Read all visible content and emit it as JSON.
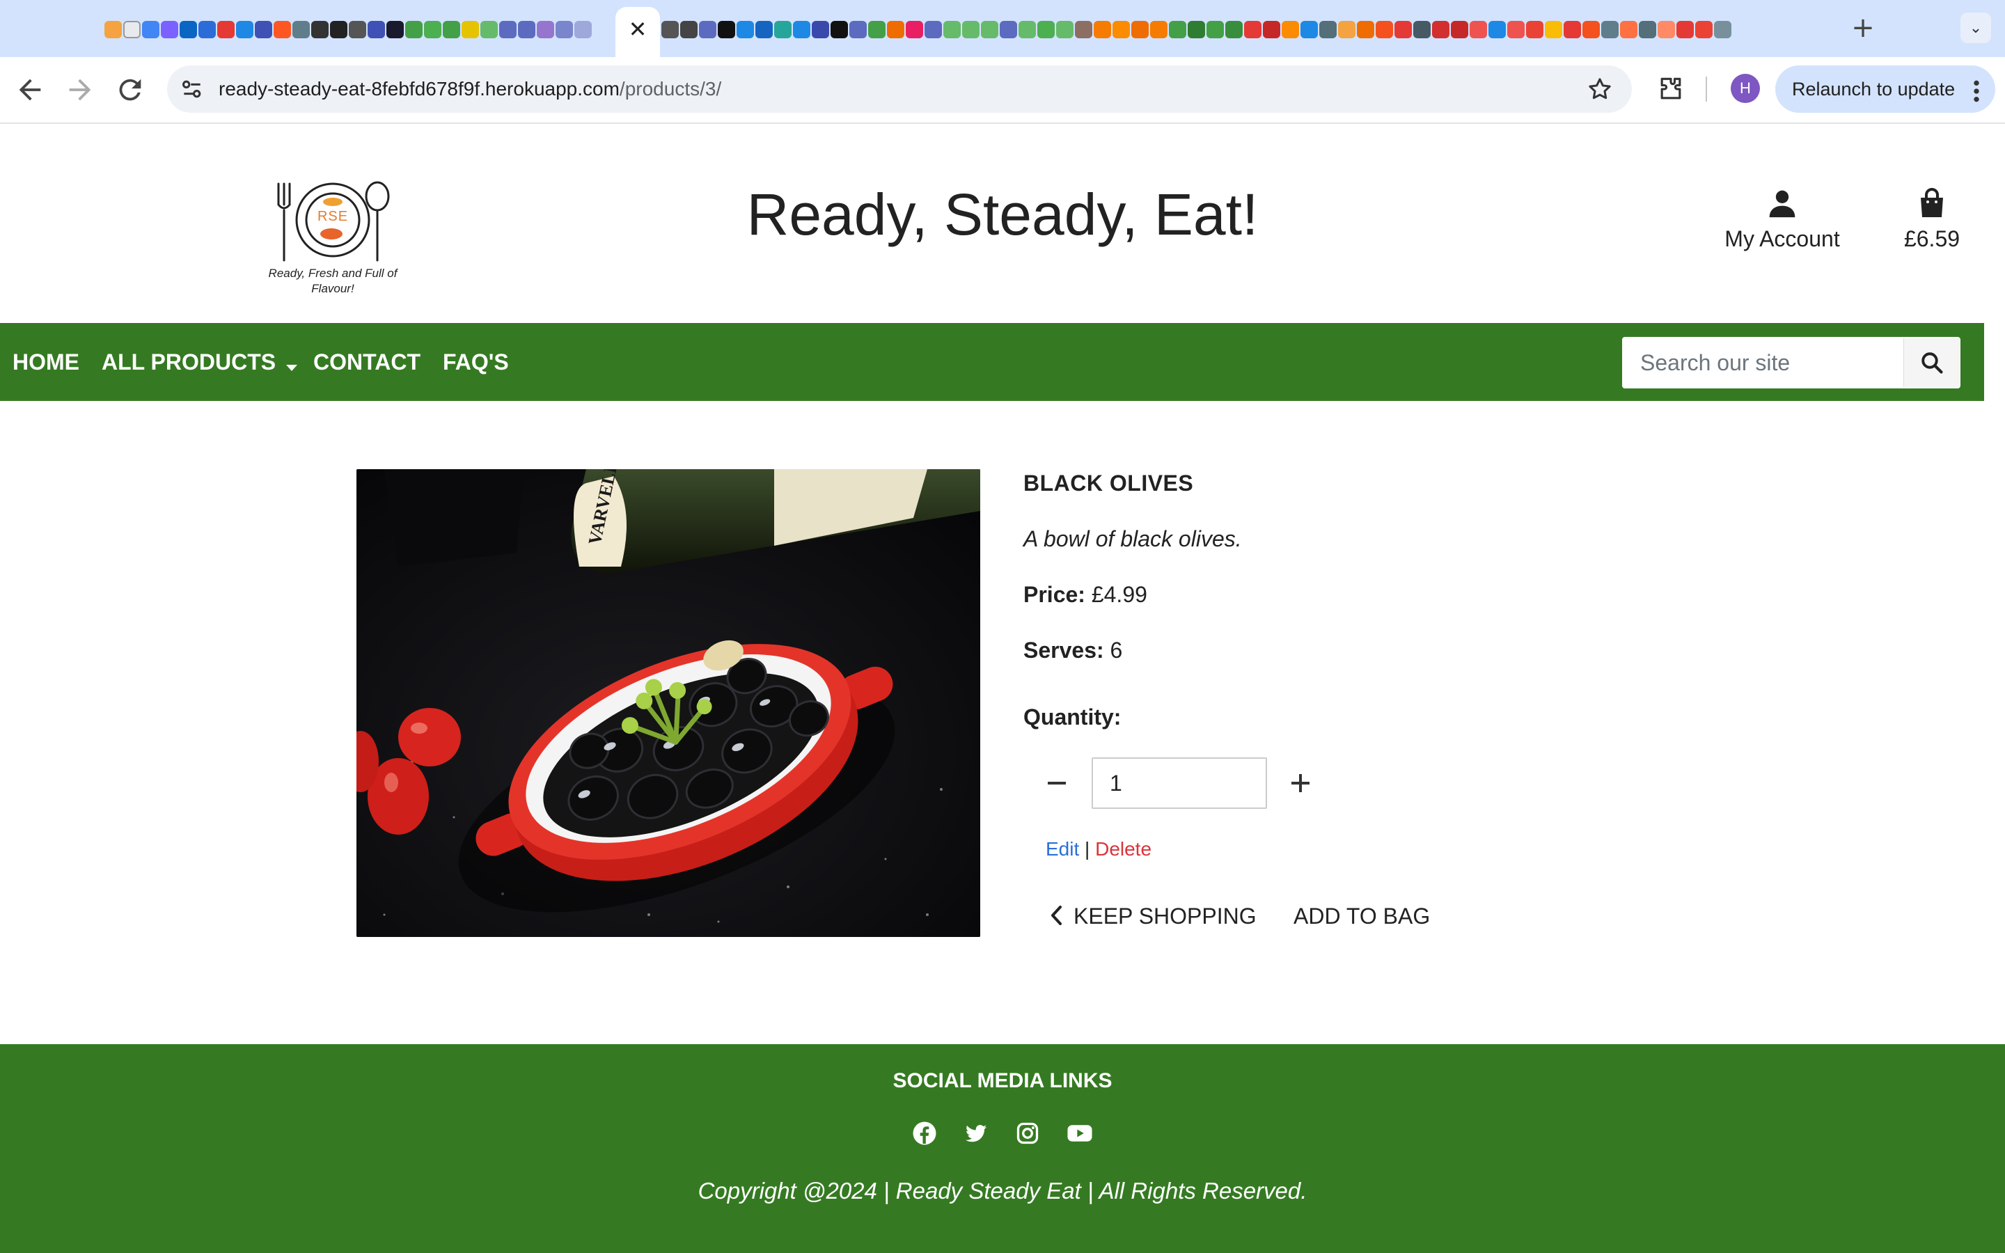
{
  "browser": {
    "url_host": "ready-steady-eat-8febfd678f9f.herokuapp.com",
    "url_path": "/products/3/",
    "relaunch_label": "Relaunch to update",
    "profile_initial": "H",
    "tab_close": "✕",
    "new_tab": "+",
    "tab_list": "⌄",
    "icons": [
      "back-arrow-icon",
      "forward-arrow-icon",
      "reload-icon",
      "site-info-icon",
      "bookmark-star-icon",
      "extensions-icon",
      "kebab-menu-icon"
    ]
  },
  "site": {
    "brand": "Ready, Steady, Eat!",
    "logo_text": "RSE",
    "tagline": "Ready, Fresh and Full of Flavour!",
    "account_label": "My Account",
    "bag_total": "£6.59"
  },
  "nav": {
    "home": "HOME",
    "all_products": "ALL PRODUCTS",
    "contact": "CONTACT",
    "faqs": "FAQ'S",
    "search_placeholder": "Search our site"
  },
  "product": {
    "name": "BLACK OLIVES",
    "description": "A bowl of black olives.",
    "price_label": "Price:",
    "price": "£4.99",
    "serves_label": "Serves:",
    "serves": "6",
    "quantity_label": "Quantity:",
    "quantity": "1",
    "edit_label": "Edit",
    "separator": "|",
    "delete_label": "Delete",
    "keep_shopping": "KEEP SHOPPING",
    "add_to_bag": "ADD TO BAG",
    "bottle_label": "VARVELLO"
  },
  "footer": {
    "title": "SOCIAL MEDIA LINKS",
    "copyright": "Copyright @2024 | Ready Steady Eat | All Rights Reserved.",
    "social_icons": [
      "facebook-icon",
      "twitter-icon",
      "instagram-icon",
      "youtube-icon"
    ]
  },
  "colors": {
    "brand_green": "#357a22",
    "edit_blue": "#2a6fdb",
    "delete_red": "#d9343a",
    "tabstrip": "#d3e3fd"
  }
}
